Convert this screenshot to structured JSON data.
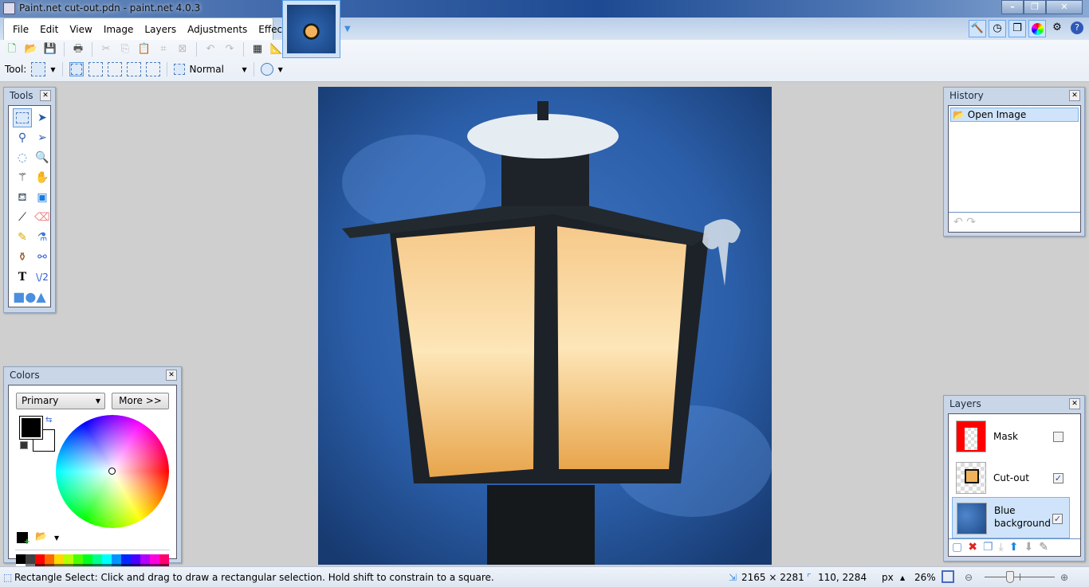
{
  "window": {
    "title": "Paint.net cut-out.pdn - paint.net 4.0.3",
    "controls": [
      "minimize",
      "restore",
      "close"
    ]
  },
  "menu": [
    "File",
    "Edit",
    "View",
    "Image",
    "Layers",
    "Adjustments",
    "Effects"
  ],
  "right_icons": [
    "tools-icon",
    "history-icon",
    "layers-icon",
    "colors-icon",
    "settings-icon",
    "help-icon"
  ],
  "toolbar": {
    "tool_label": "Tool:",
    "blend_mode": "Normal"
  },
  "tools_panel": {
    "title": "Tools",
    "tools": [
      "rectangle-select",
      "move-selected",
      "lasso-select",
      "move-selection",
      "ellipse-select",
      "zoom",
      "magic-wand",
      "pan",
      "paint-bucket",
      "gradient",
      "paintbrush",
      "eraser",
      "pencil",
      "color-picker",
      "clone-stamp",
      "recolor",
      "text",
      "line-curve",
      "shapes"
    ]
  },
  "history_panel": {
    "title": "History",
    "items": [
      "Open Image"
    ]
  },
  "colors_panel": {
    "title": "Colors",
    "mode": "Primary",
    "more_label": "More >>",
    "primary": "#000000",
    "secondary": "#ffffff",
    "palette_top": [
      "#000000",
      "#404040",
      "#ff0000",
      "#ff6a00",
      "#ffd800",
      "#b6ff00",
      "#4cff00",
      "#00ff21",
      "#00ff90",
      "#00ffff",
      "#0094ff",
      "#0026ff",
      "#4800ff",
      "#b200ff",
      "#ff00dc",
      "#ff006e"
    ],
    "palette_bottom": [
      "#ffffff",
      "#808080",
      "#7f0000",
      "#7f3300",
      "#7f6a00",
      "#5b7f00",
      "#267f00",
      "#007f0e",
      "#007f46",
      "#007f7f",
      "#004a7f",
      "#00137f",
      "#21007f",
      "#57007f",
      "#7f006e",
      "#7f0037"
    ]
  },
  "layers_panel": {
    "title": "Layers",
    "layers": [
      {
        "name": "Mask",
        "visible": false
      },
      {
        "name": "Cut-out",
        "visible": true
      },
      {
        "name": "Blue background",
        "visible": true,
        "selected": true
      }
    ]
  },
  "status": {
    "hint": "Rectangle Select: Click and drag to draw a rectangular selection. Hold shift to constrain to a square.",
    "image_size": "2165 × 2281",
    "cursor": "110, 2284",
    "units": "px",
    "zoom": "26%",
    "zoom_level": 26
  }
}
